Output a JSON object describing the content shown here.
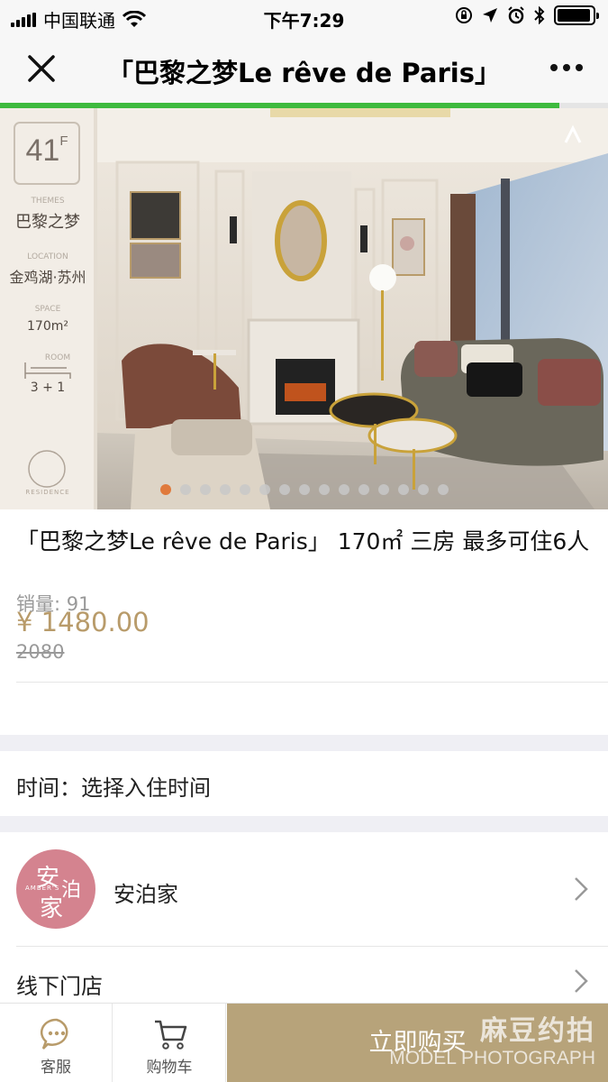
{
  "status_bar": {
    "carrier": "中国联通",
    "time": "下午7:29",
    "battery_level": 0.95
  },
  "nav": {
    "title": "「巴黎之梦Le rêve de Paris」",
    "close_icon": "close-icon",
    "more_icon": "more-icon"
  },
  "page_load_progress": 0.92,
  "hero": {
    "floor": "41",
    "floor_suffix": "F",
    "themes_label": "THEMES",
    "themes_value": "巴黎之梦",
    "location_label": "LOCATION",
    "location_value": "金鸡湖·苏州",
    "space_label": "SPACE",
    "space_value": "170m²",
    "room_label": "ROOM",
    "room_value": "3 + 1",
    "brand_small": "RESIDENCE",
    "slide_count": 15,
    "active_slide": 1
  },
  "product": {
    "title": "「巴黎之梦Le rêve de Paris」 170㎡ 三房 最多可住6人",
    "price": "¥ 1480.00",
    "original_price": "2080",
    "sales": "销量: 91"
  },
  "time_row": {
    "label": "时间：选择入住时间"
  },
  "shop": {
    "name": "安泊家",
    "logo_text_en": "AMBER'S",
    "store_label": "线下门店"
  },
  "bottom_bar": {
    "service_label": "客服",
    "cart_label": "购物车",
    "buy_label": "立即购买"
  },
  "watermark": {
    "cn": "麻豆约拍",
    "en": "MODEL PHOTOGRAPH"
  },
  "colors": {
    "accent_gold": "#b89b6a",
    "buy_button": "#b7a37a",
    "progress_green": "#3eba3e",
    "active_dot": "#e07a3c",
    "shop_logo": "#d4838f"
  }
}
